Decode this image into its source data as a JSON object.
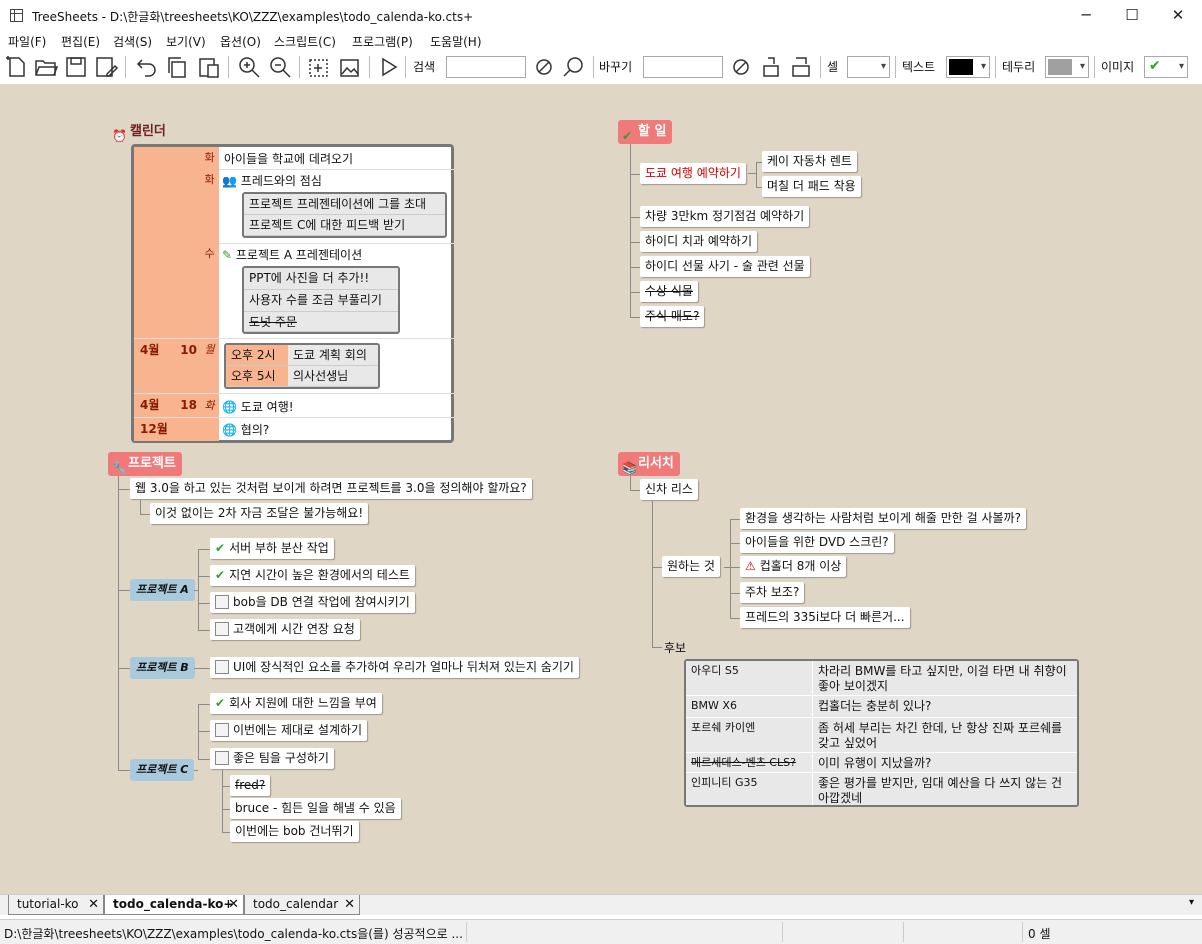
{
  "window": {
    "title": "TreeSheets - D:\\한글화\\treesheets\\KO\\ZZZ\\examples\\todo_calenda-ko.cts+",
    "minimize": "─",
    "maximize": "☐",
    "close": "✕"
  },
  "menu": [
    "파일(F)",
    "편집(E)",
    "검색(S)",
    "보기(V)",
    "옵션(O)",
    "스크립트(C)",
    "프로그램(P)",
    "도움말(H)"
  ],
  "toolbar": {
    "search_label": "검색",
    "replace_label": "바꾸기",
    "cell_label": "셀",
    "text_label": "텍스트",
    "border_label": "테두리",
    "image_label": "이미지",
    "text_color": "#000000",
    "border_color": "#a0a0a0"
  },
  "calendar": {
    "title": "캘린더",
    "rows": [
      {
        "wd": "화",
        "text": "아이들을 학교에 데려오기"
      },
      {
        "wd": "화",
        "text": "프레드와의 점심",
        "sub": [
          "프로젝트 프레젠테이션에 그를 초대",
          "프로젝트 C에 대한 피드백 받기"
        ]
      },
      {
        "wd": "수",
        "text": "프로젝트 A 프레젠테이션",
        "sub": [
          "PPT에 사진을 더 추가!!",
          "사용자 수를 조금 부풀리기",
          "도넛 주문"
        ]
      },
      {
        "month": "4월",
        "day": "10",
        "wd": "월",
        "times": [
          [
            "오후 2시",
            "도쿄 계획 회의"
          ],
          [
            "오후 5시",
            "의사선생님"
          ]
        ]
      },
      {
        "month": "4월",
        "day": "18",
        "wd": "화",
        "text": "도쿄 여행!"
      },
      {
        "month": "12월",
        "text": "협의?"
      }
    ]
  },
  "todo": {
    "title": "할 일",
    "items": [
      "도쿄 여행 예약하기",
      "차량 3만km 정기점검 예약하기",
      "하이디 치과 예약하기",
      "하이디 선물 사기 - 술 관련 선물",
      "수상 식물",
      "주식 매도?"
    ],
    "sub": [
      "케이 자동차 렌트",
      "며칠 더 패드 착용"
    ]
  },
  "projects": {
    "title": "프로젝트",
    "q": "웹 3.0을 하고 있는 것처럼 보이게 하려면 프로젝트를 3.0을 정의해야 할까요?",
    "q_sub": "이것 없이는 2차 자금 조달은 불가능해요!",
    "a_label": "프로젝트 A",
    "a_items": [
      "서버 부하 분산 작업",
      "지연 시간이 높은 환경에서의 테스트",
      "bob을 DB 연결 작업에 참여시키기",
      "고객에게 시간 연장 요청"
    ],
    "b_label": "프로젝트 B",
    "b_items": [
      "UI에 장식적인 요소를 추가하여 우리가 얼마나 뒤처져 있는지 숨기기"
    ],
    "c_label": "프로젝트 C",
    "c_items": [
      "회사 지원에 대한 느낌을 부여",
      "이번에는 제대로 설계하기",
      "좋은 팀을 구성하기"
    ],
    "c_sub": [
      "fred?",
      "bruce - 힘든 일을 해낼 수 있음",
      "이번에는 bob 건너뛰기"
    ]
  },
  "research": {
    "title": "리서치",
    "new_car": "신차 리스",
    "wants_label": "원하는 것",
    "wants": [
      "환경을 생각하는 사람처럼 보이게 해줄 만한 걸 사볼까?",
      "아이들을 위한 DVD 스크린?",
      "컵홀더 8개 이상",
      "주차 보조?",
      "프레드의 335i보다 더 빠른거..."
    ],
    "cand_label": "후보",
    "cars": [
      [
        "아우디 S5",
        "차라리 BMW를 타고 싶지만, 이걸 타면 내 취향이 좋아 보이겠지"
      ],
      [
        "BMW X6",
        "컵홀더는 충분히 있나?"
      ],
      [
        "포르쉐 카이엔",
        "좀 허세 부리는 차긴 한데, 난 항상 진짜 포르쉐를 갖고 싶었어"
      ],
      [
        "메르세데스-벤츠 CLS?",
        "이미 유행이 지났을까?"
      ],
      [
        "인피니티 G35",
        "좋은 평가를 받지만, 임대 예산을 다 쓰지 않는 건 아깝겠네"
      ]
    ]
  },
  "tabs": [
    "tutorial-ko",
    "todo_calenda-ko+",
    "todo_calendar"
  ],
  "status": {
    "path": "D:\\한글화\\treesheets\\KO\\ZZZ\\examples\\todo_calenda-ko.cts을(를) 성공적으로 ...",
    "cells": "0 셀"
  }
}
